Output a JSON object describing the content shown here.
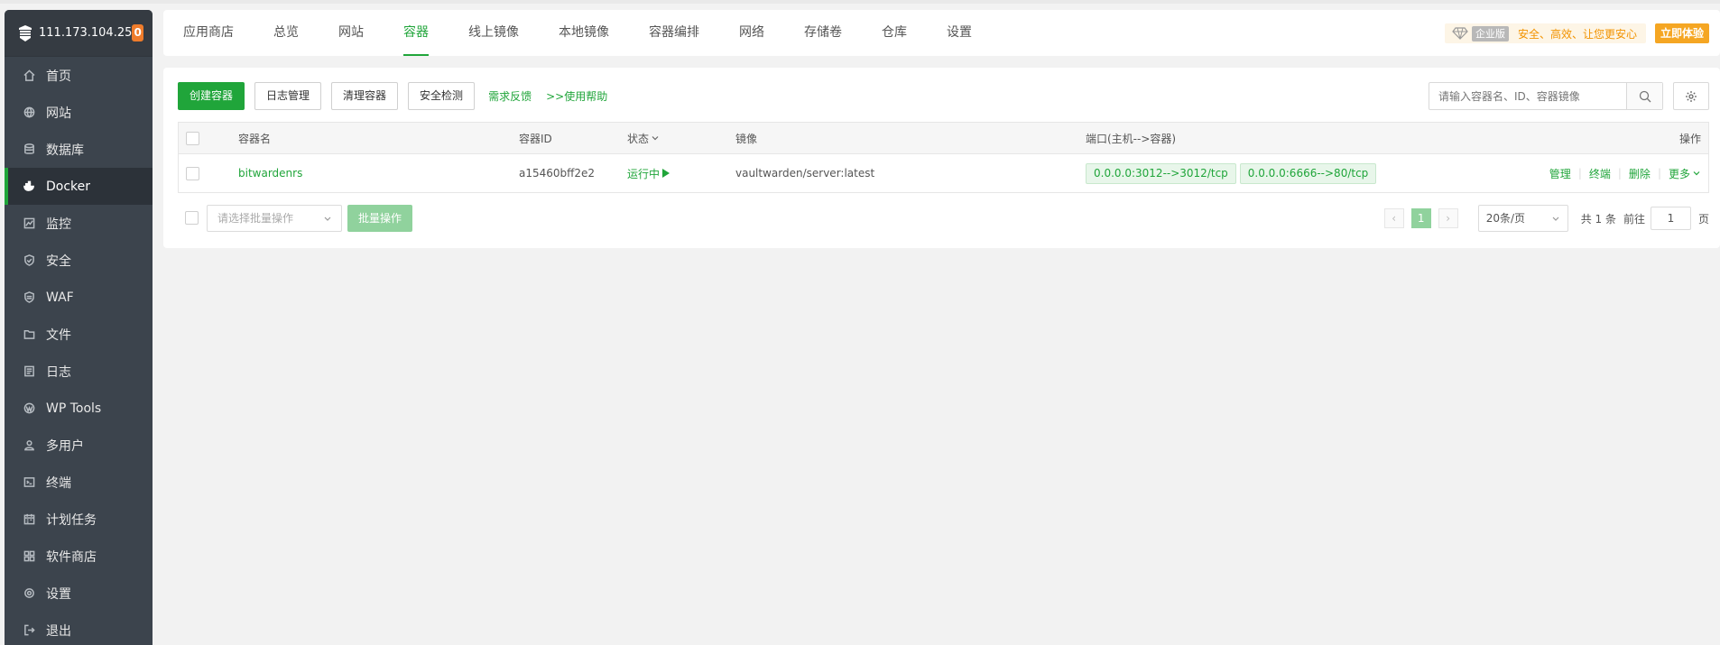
{
  "sidebar": {
    "server_ip": "111.173.104.25",
    "badge_count": "0",
    "items": [
      {
        "label": "首页",
        "icon": "home-icon"
      },
      {
        "label": "网站",
        "icon": "globe-icon"
      },
      {
        "label": "数据库",
        "icon": "database-icon"
      },
      {
        "label": "Docker",
        "icon": "docker-icon"
      },
      {
        "label": "监控",
        "icon": "monitor-icon"
      },
      {
        "label": "安全",
        "icon": "shield-icon"
      },
      {
        "label": "WAF",
        "icon": "waf-shield-icon"
      },
      {
        "label": "文件",
        "icon": "folder-icon"
      },
      {
        "label": "日志",
        "icon": "log-icon"
      },
      {
        "label": "WP Tools",
        "icon": "wordpress-icon"
      },
      {
        "label": "多用户",
        "icon": "users-icon"
      },
      {
        "label": "终端",
        "icon": "terminal-icon"
      },
      {
        "label": "计划任务",
        "icon": "calendar-icon"
      },
      {
        "label": "软件商店",
        "icon": "grid-icon"
      },
      {
        "label": "设置",
        "icon": "gear-icon"
      },
      {
        "label": "退出",
        "icon": "logout-icon"
      }
    ],
    "active": "Docker"
  },
  "tabs": [
    "应用商店",
    "总览",
    "网站",
    "容器",
    "线上镜像",
    "本地镜像",
    "容器编排",
    "网络",
    "存储卷",
    "仓库",
    "设置"
  ],
  "active_tab": "容器",
  "enterprise": {
    "label": "企业版",
    "slogan": "安全、高效、让您更安心",
    "try_label": "立即体验"
  },
  "toolbar": {
    "create": "创建容器",
    "logs": "日志管理",
    "clean": "清理容器",
    "security": "安全检测",
    "feedback": "需求反馈",
    "help": ">>使用帮助"
  },
  "search": {
    "placeholder": "请输入容器名、ID、容器镜像"
  },
  "table": {
    "headers": {
      "name": "容器名",
      "id": "容器ID",
      "status": "状态",
      "image": "镜像",
      "port": "端口(主机-->容器)",
      "ops": "操作"
    },
    "rows": [
      {
        "name": "bitwardenrs",
        "id": "a15460bff2e2",
        "status": "运行中",
        "image": "vaultwarden/server:latest",
        "ports": [
          "0.0.0.0:3012-->3012/tcp",
          "0.0.0.0:6666-->80/tcp"
        ],
        "ops": [
          "管理",
          "终端",
          "删除",
          "更多"
        ]
      }
    ]
  },
  "footer": {
    "batch_placeholder": "请选择批量操作",
    "batch_button": "批量操作",
    "current_page": "1",
    "page_size": "20条/页",
    "total": "共 1 条",
    "goto_label": "前往",
    "goto_value": "1",
    "page_suffix": "页"
  },
  "colors": {
    "accent": "#20a53a",
    "sidebar_bg": "#3c444d",
    "badge": "#ef7c2b",
    "enterprise_gold": "#f29300"
  }
}
